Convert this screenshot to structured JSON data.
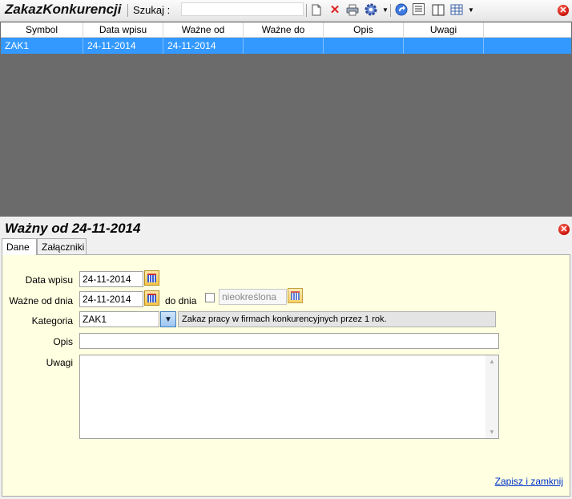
{
  "toolbar": {
    "title": "ZakazKonkurencji",
    "search_label": "Szukaj :",
    "search_value": "",
    "icons": [
      "new-document-icon",
      "delete-icon",
      "print-icon",
      "settings-icon",
      "refresh-icon",
      "report-icon",
      "columns-icon",
      "grid-layout-icon",
      "close-icon"
    ]
  },
  "grid": {
    "columns": [
      "Symbol",
      "Data wpisu",
      "Ważne od",
      "Ważne do",
      "Opis",
      "Uwagi"
    ],
    "rows": [
      {
        "symbol": "ZAK1",
        "data_wpisu": "24-11-2014",
        "wazne_od": "24-11-2014",
        "wazne_do": "",
        "opis": "",
        "uwagi": ""
      }
    ]
  },
  "detail": {
    "title": "Ważny od 24-11-2014",
    "tabs": [
      "Dane",
      "Załączniki"
    ],
    "active_tab": "Dane",
    "form": {
      "data_wpisu_label": "Data wpisu",
      "data_wpisu_value": "24-11-2014",
      "wazne_od_label": "Ważne od dnia",
      "wazne_od_value": "24-11-2014",
      "do_dnia_label": "do dnia",
      "do_dnia_value": "nieokreślona",
      "kategoria_label": "Kategoria",
      "kategoria_value": "ZAK1",
      "kategoria_desc": "Zakaz pracy w firmach konkurencyjnych przez 1 rok.",
      "opis_label": "Opis",
      "opis_value": "",
      "uwagi_label": "Uwagi",
      "uwagi_value": ""
    },
    "save_link": "Zapisz i zamknij"
  },
  "colors": {
    "selection": "#3399ff",
    "form_background": "#ffffe1",
    "grid_background": "#6b6b6b"
  }
}
